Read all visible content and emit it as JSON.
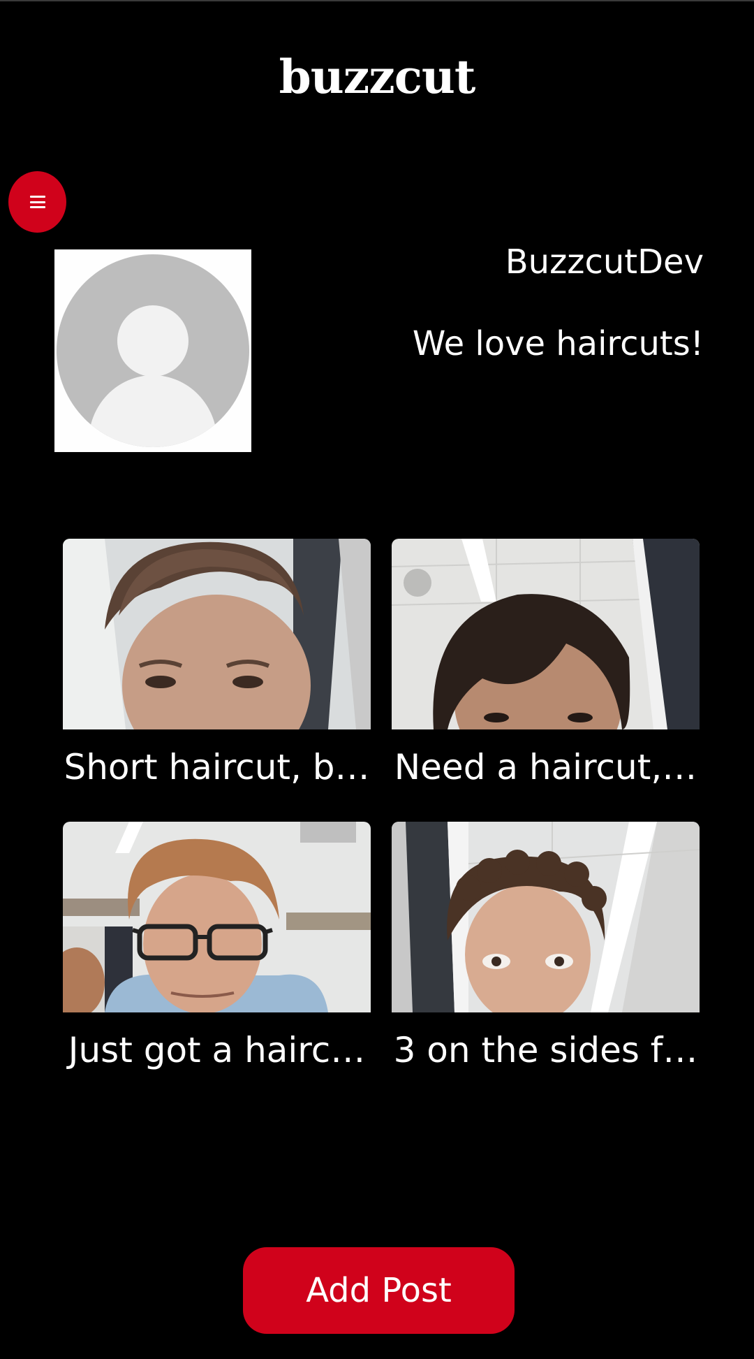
{
  "header": {
    "app_title": "buzzcut"
  },
  "menu": {
    "icon": "hamburger-menu-icon"
  },
  "profile": {
    "avatar_icon": "default-avatar-icon",
    "username": "BuzzcutDev",
    "bio": "We love haircuts!"
  },
  "posts": [
    {
      "caption": "Short haircut, b…"
    },
    {
      "caption": "Need a haircut,…"
    },
    {
      "caption": "Just got a hairc…"
    },
    {
      "caption": "3 on the sides f…"
    }
  ],
  "actions": {
    "add_post_label": "Add Post"
  },
  "colors": {
    "accent": "#d0021b",
    "background": "#000000",
    "text": "#ffffff"
  }
}
